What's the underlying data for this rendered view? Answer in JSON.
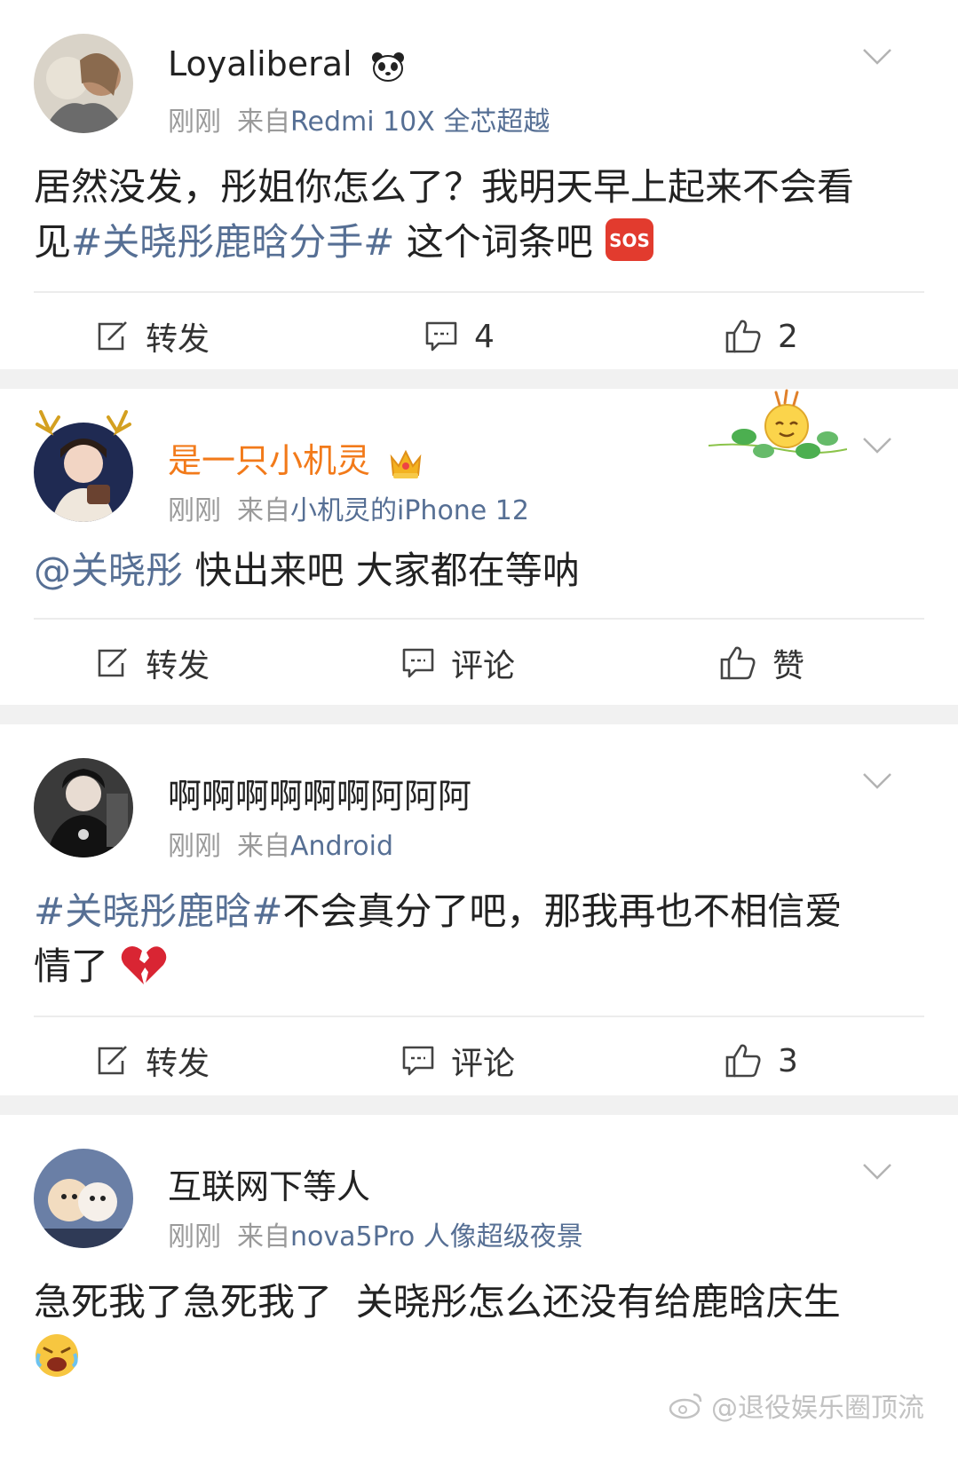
{
  "posts": [
    {
      "username": "Loyaliberal",
      "username_emoji": "panda",
      "time": "刚刚",
      "source_prefix": "来自",
      "source": "Redmi 10X 全芯超越",
      "content": {
        "line1": "居然没发，彤姐你怎么了？我明天早上起来不会看",
        "line2_prefix": "见",
        "hashtag": "#关晓彤鹿晗分手#",
        "line2_suffix": " 这个词条吧",
        "emoji": "sos"
      },
      "actions": {
        "repost": "转发",
        "comment": "4",
        "like": "2"
      }
    },
    {
      "username": "是一只小机灵",
      "username_emoji": "crown",
      "time": "刚刚",
      "source_prefix": "来自",
      "source": "小机灵的iPhone 12",
      "content": {
        "mention": "@关晓彤",
        "text": " 快出来吧 大家都在等呐"
      },
      "actions": {
        "repost": "转发",
        "comment": "评论",
        "like": "赞"
      }
    },
    {
      "username": "啊啊啊啊啊啊阿阿阿",
      "time": "刚刚",
      "source_prefix": "来自",
      "source": "Android",
      "content": {
        "hashtag": "#关晓彤鹿晗#",
        "text1": "不会真分了吧，那我再也不相信爱",
        "line2": "情了",
        "emoji": "broken-heart"
      },
      "actions": {
        "repost": "转发",
        "comment": "评论",
        "like": "3"
      }
    },
    {
      "username": "互联网下等人",
      "time": "刚刚",
      "source_prefix": "来自",
      "source": "nova5Pro 人像超级夜景",
      "content": {
        "line1": "急死我了急死我了  关晓彤怎么还没有给鹿晗庆生",
        "emoji": "crying-face"
      }
    }
  ],
  "watermark": "@退役娱乐圈顶流",
  "colors": {
    "link": "#566f94",
    "vip_name": "#f27a1a",
    "meta": "#9a9a9a",
    "separator": "#f1f1f1"
  }
}
